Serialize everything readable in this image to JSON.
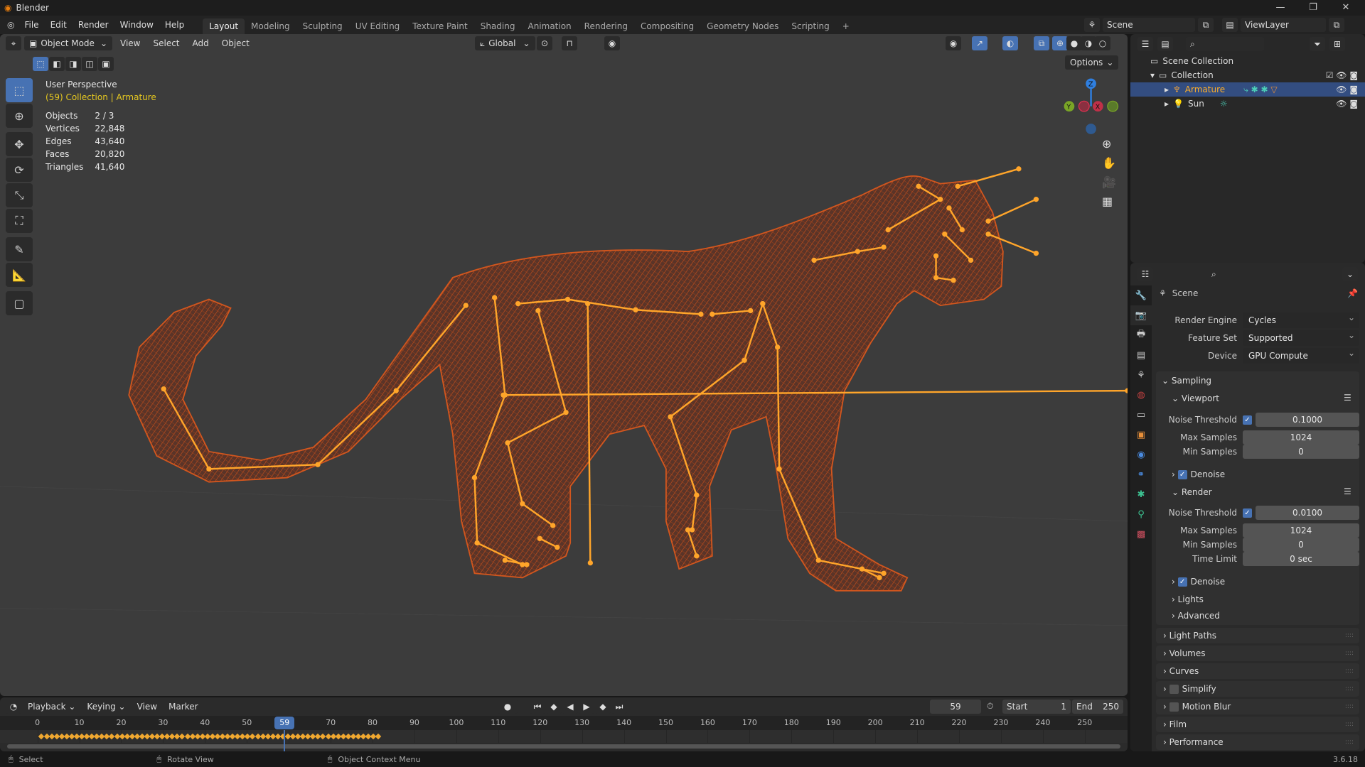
{
  "window": {
    "title": "Blender",
    "controls": [
      "—",
      "❐",
      "✕"
    ]
  },
  "menus": [
    "File",
    "Edit",
    "Render",
    "Window",
    "Help"
  ],
  "workspaces": [
    {
      "label": "Layout",
      "active": true
    },
    {
      "label": "Modeling"
    },
    {
      "label": "Sculpting"
    },
    {
      "label": "UV Editing"
    },
    {
      "label": "Texture Paint"
    },
    {
      "label": "Shading"
    },
    {
      "label": "Animation"
    },
    {
      "label": "Rendering"
    },
    {
      "label": "Compositing"
    },
    {
      "label": "Geometry Nodes"
    },
    {
      "label": "Scripting"
    },
    {
      "label": "+"
    }
  ],
  "scene": {
    "name": "Scene",
    "view_layer": "ViewLayer"
  },
  "viewport": {
    "mode": "Object Mode",
    "menus": [
      "View",
      "Select",
      "Add",
      "Object"
    ],
    "orientation": "Global",
    "options": "Options",
    "perspective": "User Perspective",
    "context": "(59) Collection | Armature",
    "stats": [
      {
        "label": "Objects",
        "value": "2 / 3"
      },
      {
        "label": "Vertices",
        "value": "22,848"
      },
      {
        "label": "Edges",
        "value": "43,640"
      },
      {
        "label": "Faces",
        "value": "20,820"
      },
      {
        "label": "Triangles",
        "value": "41,640"
      }
    ],
    "gizmo": {
      "z": "Z",
      "y": "Y",
      "x": "X"
    },
    "wire_color": "#d2561e",
    "bone_color": "#ffa52a"
  },
  "outliner": {
    "root": "Scene Collection",
    "collection": "Collection",
    "items": [
      {
        "name": "Armature",
        "selected": true,
        "color": "#ffaf29"
      },
      {
        "name": "Sun",
        "selected": false,
        "color": "#dddddd"
      }
    ]
  },
  "properties": {
    "context": "Scene",
    "render_engine": {
      "label": "Render Engine",
      "value": "Cycles"
    },
    "feature_set": {
      "label": "Feature Set",
      "value": "Supported"
    },
    "device": {
      "label": "Device",
      "value": "GPU Compute"
    },
    "sampling": {
      "title": "Sampling",
      "viewport": {
        "title": "Viewport",
        "noise_label": "Noise Threshold",
        "noise": "0.1000",
        "max_label": "Max Samples",
        "max": "1024",
        "min_label": "Min Samples",
        "min": "0",
        "denoise": "Denoise"
      },
      "render": {
        "title": "Render",
        "noise_label": "Noise Threshold",
        "noise": "0.0100",
        "max_label": "Max Samples",
        "max": "1024",
        "min_label": "Min Samples",
        "min": "0",
        "time_label": "Time Limit",
        "time": "0 sec",
        "denoise": "Denoise"
      },
      "lights": "Lights",
      "advanced": "Advanced"
    },
    "panels": [
      {
        "label": "Light Paths"
      },
      {
        "label": "Volumes"
      },
      {
        "label": "Curves"
      },
      {
        "label": "Simplify",
        "checkbox": true
      },
      {
        "label": "Motion Blur",
        "checkbox": true
      },
      {
        "label": "Film"
      },
      {
        "label": "Performance"
      }
    ]
  },
  "timeline": {
    "menus": [
      "Playback",
      "Keying",
      "View",
      "Marker"
    ],
    "current_frame": "59",
    "start_label": "Start",
    "start": "1",
    "end_label": "End",
    "end": "250",
    "frame_max": 250,
    "keyframe_last": 82,
    "ticks": [
      "0",
      "10",
      "20",
      "30",
      "40",
      "50",
      "60",
      "70",
      "80",
      "90",
      "100",
      "110",
      "120",
      "130",
      "140",
      "150",
      "160",
      "170",
      "180",
      "190",
      "200",
      "210",
      "220",
      "230",
      "240",
      "250"
    ]
  },
  "statusbar": {
    "select": "Select",
    "rotate": "Rotate View",
    "context_menu": "Object Context Menu",
    "version": "3.6.18"
  }
}
